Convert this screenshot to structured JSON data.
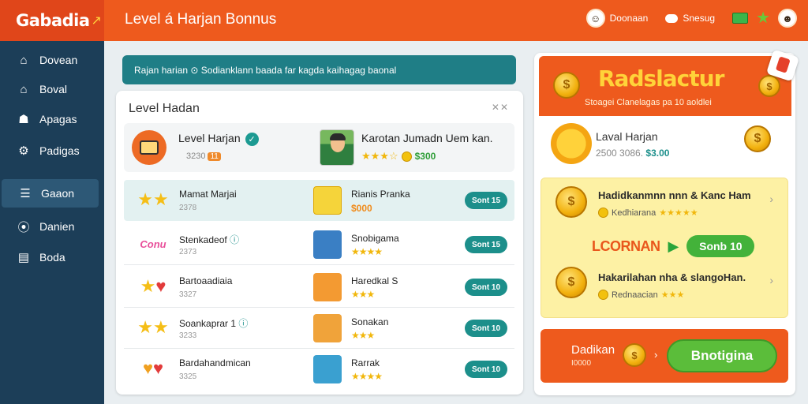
{
  "app": {
    "logo": "Gabadia",
    "page_title": "Level á Harjan Bonnus"
  },
  "topbar": {
    "user_label": "Doonaan",
    "cloud_label": "Snesug"
  },
  "sidebar": {
    "items": [
      {
        "label": "Dovean",
        "icon": "home-icon"
      },
      {
        "label": "Boval",
        "icon": "house-icon"
      },
      {
        "label": "Apagas",
        "icon": "users-icon"
      },
      {
        "label": "Padigas",
        "icon": "gear-icon"
      },
      {
        "label": "Gaaon",
        "icon": "list-icon",
        "active": true
      },
      {
        "label": "Danien",
        "icon": "pin-icon"
      },
      {
        "label": "Boda",
        "icon": "wallet-icon"
      }
    ]
  },
  "banner": {
    "text": "Rajan harian ⊙  Sodianklann baada far kagda kaihagag baonal"
  },
  "level_panel": {
    "title": "Level Hadan",
    "close_label": "✕✕",
    "featured": {
      "name": "Level Harjan",
      "sub": "3230",
      "tag": "11",
      "second_name": "Karotan Jumadn Uem kan.",
      "second_price": "$300"
    },
    "rows": [
      {
        "name": "Mamat Marjai",
        "sub": "2378",
        "title": "Rianis Pranka",
        "price": "$000",
        "button": "Sont 15"
      },
      {
        "name": "Stenkadeof",
        "sub": "2373",
        "title": "Snobigama",
        "button": "Sont 15",
        "brand": "Conu"
      },
      {
        "name": "Bartoaadiaia",
        "sub": "3327",
        "title": "Haredkal S",
        "button": "Sont 10"
      },
      {
        "name": "Soankaprar 1",
        "sub": "3233",
        "title": "Sonakan",
        "button": "Sont 10"
      },
      {
        "name": "Bardahandmican",
        "sub": "3325",
        "title": "Rarrak",
        "button": "Sont 10"
      }
    ]
  },
  "rewards": {
    "title": "Radslactur",
    "subtitle": "Stoagei Clanelagas pa 10 aoldlei",
    "level_name": "Laval Harjan",
    "level_sub_prefix": "2500 3086.",
    "level_sub_price": "$3.00",
    "card1_title": "Hadidkanmnn nnn & Kanc Ham",
    "card1_sub": "Kedhiarana",
    "mid_label": "LCORNAN",
    "mid_button": "Sonb 10",
    "card2_title": "Hakarilahan nha & slangoHan.",
    "card2_sub": "Rednaacian",
    "bottom_label": "Dadikan",
    "bottom_sub": "I0000",
    "bottom_button": "Bnotigina"
  },
  "colors": {
    "accent": "#ee5a1d",
    "sidebar": "#1c3e58",
    "teal": "#1c8f8b",
    "green": "#43b23a",
    "yellow": "#fdf1a4"
  }
}
